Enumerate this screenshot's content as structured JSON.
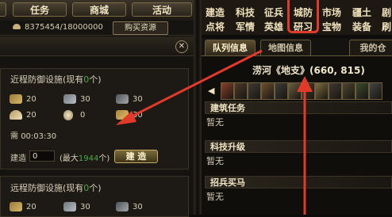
{
  "top_nav": {
    "items": [
      "任务",
      "商城",
      "活动"
    ]
  },
  "resources": {
    "gold": "8375454/18000000",
    "buy_label": "购买资源"
  },
  "left_panel": {
    "near_defense": {
      "title": "近程防御设施",
      "owned_prefix": "(现有",
      "owned_count": "0",
      "owned_suffix": "个)",
      "costs": [
        "20",
        "30",
        "30",
        "20",
        "0",
        "30"
      ],
      "time_prefix": "需",
      "time": "00:03:30",
      "build_label": "建造",
      "build_qty": "0",
      "max_prefix": "(最大",
      "max_count": "1944",
      "max_suffix": "个)",
      "build_button": "建 造"
    },
    "far_defense": {
      "title": "远程防御设施",
      "owned_prefix": "(现有",
      "owned_count": "0",
      "owned_suffix": "个)",
      "costs": [
        "20",
        "30",
        "30"
      ]
    }
  },
  "right_menu": {
    "row1": [
      "建造",
      "科技",
      "征兵",
      "城防",
      "市场",
      "疆土",
      "剧"
    ],
    "row2": [
      "点将",
      "军情",
      "英雄",
      "研习",
      "宝物",
      "装备",
      "刷"
    ],
    "highlighted": "城防"
  },
  "right_tabs": [
    "队列信息",
    "地图信息",
    "我的仓"
  ],
  "location": {
    "name": "涝河《地支》",
    "coords": "(660, 815)"
  },
  "unit_icon_colors": [
    "#8a3f2a",
    "#4c3a29",
    "#3f3a33",
    "#6d4f2d",
    "#3d3b35",
    "#6a5f3e",
    "#4d3d2a",
    "#7c6c3f",
    "#3e3a32",
    "#4d4530",
    "#3b4a2e",
    "#40453f"
  ],
  "sections": [
    {
      "title": "建筑任务",
      "value": "暂无"
    },
    {
      "title": "科技升级",
      "value": "暂无"
    },
    {
      "title": "招兵买马",
      "value": "暂无"
    }
  ],
  "colors": {
    "highlight_frame": "#e03a2a",
    "green_text": "#4aa84a",
    "annotation_arrow": "#e23a2a"
  }
}
